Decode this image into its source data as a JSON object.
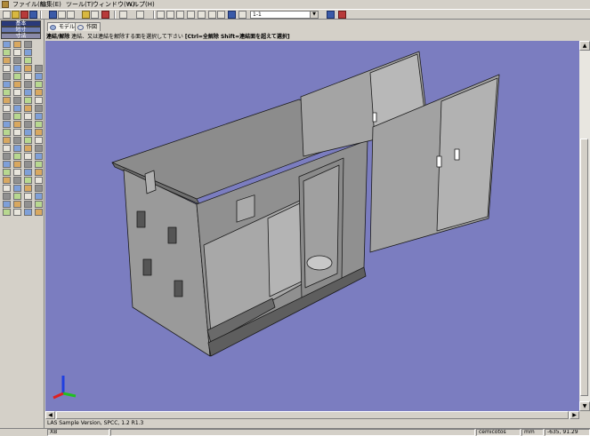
{
  "menu": [
    {
      "label": "ファイル(F)"
    },
    {
      "label": "編集(E)"
    },
    {
      "label": "ツール(T)"
    },
    {
      "label": "ウィンドウ(W)"
    },
    {
      "label": "ヘルプ(H)"
    }
  ],
  "toolbar": {
    "view_combo_value": "1-1"
  },
  "left_panel": {
    "mode_buttons": [
      "基本",
      "短寸",
      "寸法"
    ]
  },
  "tabs": [
    {
      "label": "モデル"
    },
    {
      "label": "作図"
    }
  ],
  "hint": {
    "prefix": "連結/解除",
    "text": " 連結、又は連結を解除する面を選択して下さい ",
    "shortcut": "[Ctrl=全解除 Shift=連結面を超えて選択]"
  },
  "viewport": {
    "background": "#7b7dc0",
    "axis": {
      "x_color": "#e02020",
      "y_color": "#20c020",
      "z_color": "#2040e0"
    }
  },
  "view_status": "LAS Sample Version, SPCC, 1.2 R1.3",
  "statusbar": {
    "mode": "XB",
    "snap": "cemicotos",
    "units": "mm",
    "coords": "-635, 91.29"
  }
}
